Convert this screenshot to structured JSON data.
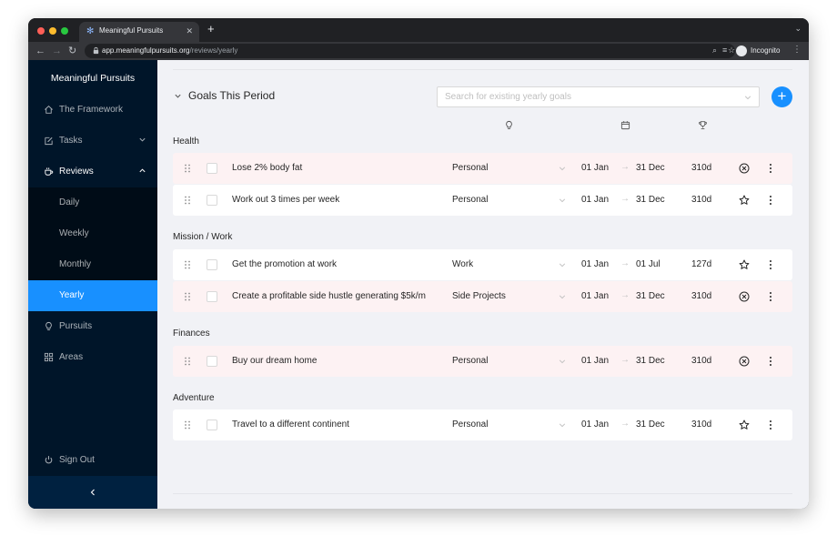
{
  "browser": {
    "tab_title": "Meaningful Pursuits",
    "new_tab": "+",
    "url_domain": "app.meaningfulpursuits.org",
    "url_path": "/reviews/yearly",
    "incognito_label": "Incognito",
    "traffic_lights": [
      "#ff5f57",
      "#febc2e",
      "#28c840"
    ]
  },
  "sidebar": {
    "brand": "Meaningful Pursuits",
    "items": [
      {
        "label": "The Framework",
        "icon": "home-icon"
      },
      {
        "label": "Tasks",
        "icon": "edit-icon"
      },
      {
        "label": "Reviews",
        "icon": "coffee-icon"
      },
      {
        "label": "Pursuits",
        "icon": "bulb-icon"
      },
      {
        "label": "Areas",
        "icon": "grid-icon"
      }
    ],
    "reviews_sub": [
      "Daily",
      "Weekly",
      "Monthly",
      "Yearly"
    ],
    "selected_sub": "Yearly",
    "sign_out": "Sign Out"
  },
  "main": {
    "title": "Goals This Period",
    "search_placeholder": "Search for existing yearly goals",
    "add_button": "+",
    "columns": [
      "bulb-icon",
      "calendar-icon",
      "trophy-icon"
    ],
    "groups": [
      {
        "name": "Health",
        "goals": [
          {
            "title": "Lose 2% body fat",
            "area": "Personal",
            "start": "01 Jan",
            "end": "31 Dec",
            "days": "310d",
            "status": "close-circle-icon",
            "highlight": true
          },
          {
            "title": "Work out 3 times per week",
            "area": "Personal",
            "start": "01 Jan",
            "end": "31 Dec",
            "days": "310d",
            "status": "star-icon",
            "highlight": false
          }
        ]
      },
      {
        "name": "Mission / Work",
        "goals": [
          {
            "title": "Get the promotion at work",
            "area": "Work",
            "start": "01 Jan",
            "end": "01 Jul",
            "days": "127d",
            "status": "star-icon",
            "highlight": false
          },
          {
            "title": "Create a profitable side hustle generating $5k/m",
            "area": "Side Projects",
            "start": "01 Jan",
            "end": "31 Dec",
            "days": "310d",
            "status": "close-circle-icon",
            "highlight": true
          }
        ]
      },
      {
        "name": "Finances",
        "goals": [
          {
            "title": "Buy our dream home",
            "area": "Personal",
            "start": "01 Jan",
            "end": "31 Dec",
            "days": "310d",
            "status": "close-circle-icon",
            "highlight": true
          }
        ]
      },
      {
        "name": "Adventure",
        "goals": [
          {
            "title": "Travel to a different continent",
            "area": "Personal",
            "start": "01 Jan",
            "end": "31 Dec",
            "days": "310d",
            "status": "star-icon",
            "highlight": false
          }
        ]
      }
    ],
    "arrow_glyph": "→"
  },
  "colors": {
    "sidebar_bg": "#001529",
    "submenu_bg": "#000c17",
    "selected": "#1890ff",
    "row_highlight": "#fdf2f3",
    "page_bg": "#f1f2f6"
  }
}
